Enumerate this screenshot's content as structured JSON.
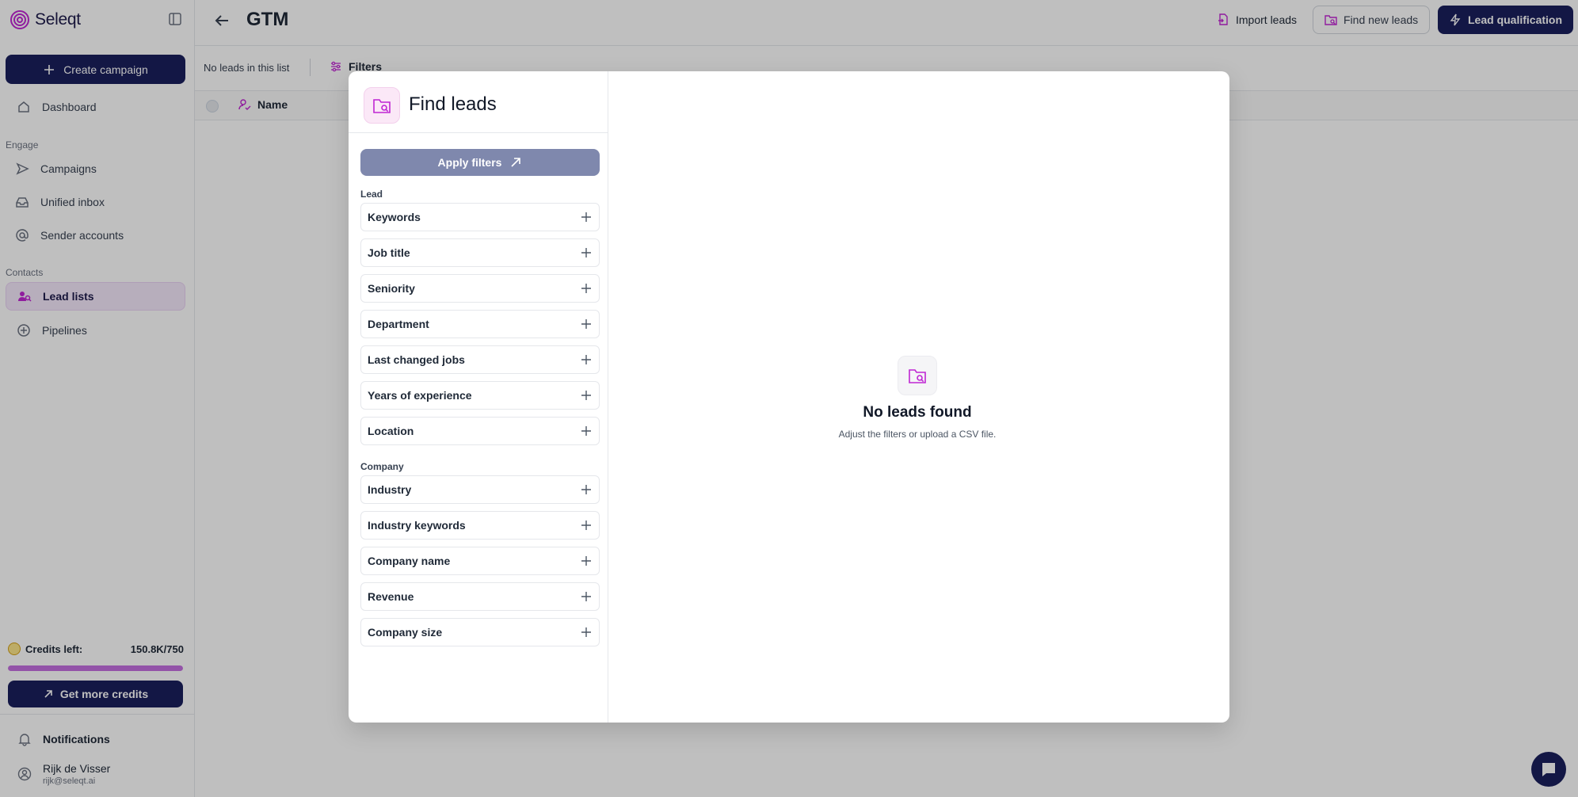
{
  "app": {
    "name": "Seleqt"
  },
  "sidebar": {
    "create_label": "Create campaign",
    "dashboard_label": "Dashboard",
    "engage_label": "Engage",
    "campaigns_label": "Campaigns",
    "inbox_label": "Unified inbox",
    "senders_label": "Sender accounts",
    "contacts_label": "Contacts",
    "lead_lists_label": "Lead lists",
    "pipelines_label": "Pipelines",
    "credits_label": "Credits left:",
    "credits_value": "150.8K/750",
    "credits_fill_fraction": 1.0,
    "get_credits_label": "Get more credits",
    "notifications_label": "Notifications",
    "user_name": "Rijk de Visser",
    "user_email": "rijk@seleqt.ai"
  },
  "topbar": {
    "title": "GTM",
    "import_label": "Import leads",
    "find_label": "Find new leads",
    "qualification_label": "Lead qualification"
  },
  "subbar": {
    "status_text": "No leads in this list",
    "filters_label": "Filters"
  },
  "table": {
    "name_header": "Name"
  },
  "modal": {
    "title": "Find leads",
    "apply_label": "Apply filters",
    "lead_group_label": "Lead",
    "lead_filters": [
      "Keywords",
      "Job title",
      "Seniority",
      "Department",
      "Last changed jobs",
      "Years of experience",
      "Location"
    ],
    "company_group_label": "Company",
    "company_filters": [
      "Industry",
      "Industry keywords",
      "Company name",
      "Revenue",
      "Company size"
    ],
    "empty_title": "No leads found",
    "empty_subtitle": "Adjust the filters or upload a CSV file."
  },
  "colors": {
    "brand_navy": "#1a1f5c",
    "accent_purple": "#c026d3",
    "overlay": "rgba(0,0,0,0.25)"
  }
}
